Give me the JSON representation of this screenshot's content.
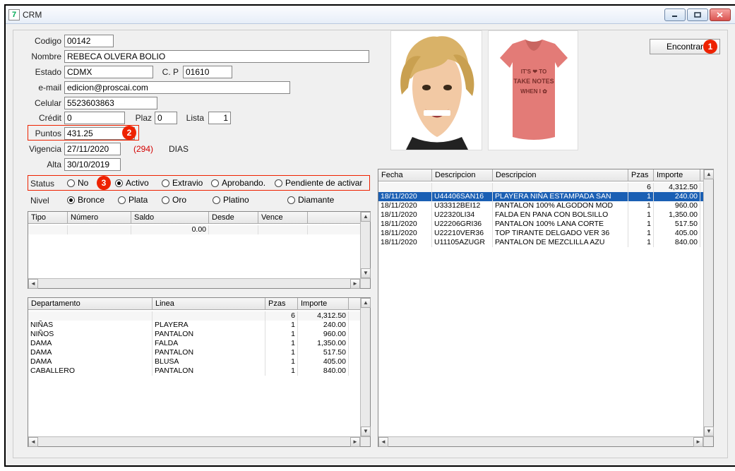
{
  "window": {
    "title": "CRM"
  },
  "buttons": {
    "encontrar": "Encontrar"
  },
  "badges": {
    "b1": "1",
    "b2": "2",
    "b3": "3"
  },
  "labels": {
    "codigo": "Codigo",
    "nombre": "Nombre",
    "estado": "Estado",
    "cp": "C. P",
    "email": "e-mail",
    "celular": "Celular",
    "credit": "Crédit",
    "plaz": "Plaz",
    "lista": "Lista",
    "puntos": "Puntos",
    "vigencia": "Vigencia",
    "alta": "Alta",
    "status": "Status",
    "nivel": "Nivel",
    "dias": "DIAS",
    "vig_days": "(294)"
  },
  "fields": {
    "codigo": "00142",
    "nombre": "REBECA OLVERA BOLIO",
    "estado": "CDMX",
    "cp": "01610",
    "email": "edicion@proscai.com",
    "celular": "5523603863",
    "credit": "0",
    "plaz": "0",
    "lista": "1",
    "puntos": "431.25",
    "vigencia": "27/11/2020",
    "alta": "30/10/2019"
  },
  "status_options": {
    "no": "No",
    "activo": "Activo",
    "extravio": "Extravio",
    "aprobando": "Aprobando.",
    "pendiente": "Pendiente de activar"
  },
  "nivel_options": {
    "bronce": "Bronce",
    "plata": "Plata",
    "oro": "Oro",
    "platino": "Platino",
    "diamante": "Diamante"
  },
  "table1": {
    "headers": {
      "tipo": "Tipo",
      "numero": "Número",
      "saldo": "Saldo",
      "desde": "Desde",
      "vence": "Vence"
    },
    "saldo_total": "0.00"
  },
  "table2": {
    "headers": {
      "dep": "Departamento",
      "linea": "Linea",
      "pzas": "Pzas",
      "importe": "Importe"
    },
    "totals": {
      "pzas": "6",
      "importe": "4,312.50"
    },
    "rows": [
      {
        "dep": "NIÑAS",
        "linea": "PLAYERA",
        "pzas": "1",
        "importe": "240.00"
      },
      {
        "dep": "NIÑOS",
        "linea": "PANTALON",
        "pzas": "1",
        "importe": "960.00"
      },
      {
        "dep": "DAMA",
        "linea": "FALDA",
        "pzas": "1",
        "importe": "1,350.00"
      },
      {
        "dep": "DAMA",
        "linea": "PANTALON",
        "pzas": "1",
        "importe": "517.50"
      },
      {
        "dep": "DAMA",
        "linea": "BLUSA",
        "pzas": "1",
        "importe": "405.00"
      },
      {
        "dep": "CABALLERO",
        "linea": "PANTALON",
        "pzas": "1",
        "importe": "840.00"
      }
    ]
  },
  "table3": {
    "headers": {
      "fecha": "Fecha",
      "desc1": "Descripcion",
      "desc2": "Descripcion",
      "pzas": "Pzas",
      "importe": "Importe"
    },
    "totals": {
      "pzas": "6",
      "importe": "4,312.50"
    },
    "rows": [
      {
        "fecha": "18/11/2020",
        "desc1": "U44406SAN16",
        "desc2": "PLAYERA NIÑA ESTAMPADA SAN",
        "pzas": "1",
        "importe": "240.00",
        "sel": true
      },
      {
        "fecha": "18/11/2020",
        "desc1": "U33312BEI12",
        "desc2": "PANTALON 100%  ALGODON MOD",
        "pzas": "1",
        "importe": "960.00"
      },
      {
        "fecha": "18/11/2020",
        "desc1": "U22320LI34",
        "desc2": "FALDA EN PANA CON BOLSILLO",
        "pzas": "1",
        "importe": "1,350.00"
      },
      {
        "fecha": "18/11/2020",
        "desc1": "U22206GRI36",
        "desc2": "PANTALON 100% LANA  CORTE",
        "pzas": "1",
        "importe": "517.50"
      },
      {
        "fecha": "18/11/2020",
        "desc1": "U22210VER36",
        "desc2": "TOP TIRANTE DELGADO VER 36",
        "pzas": "1",
        "importe": "405.00"
      },
      {
        "fecha": "18/11/2020",
        "desc1": "U11105AZUGR",
        "desc2": "PANTALON DE MEZCLILLA AZU",
        "pzas": "1",
        "importe": "840.00"
      }
    ]
  },
  "shirt_text": {
    "l1": "IT'S",
    "l2": "TO",
    "l3": "TAKE NOTES",
    "l4": "WHEN I",
    "l5": ""
  }
}
